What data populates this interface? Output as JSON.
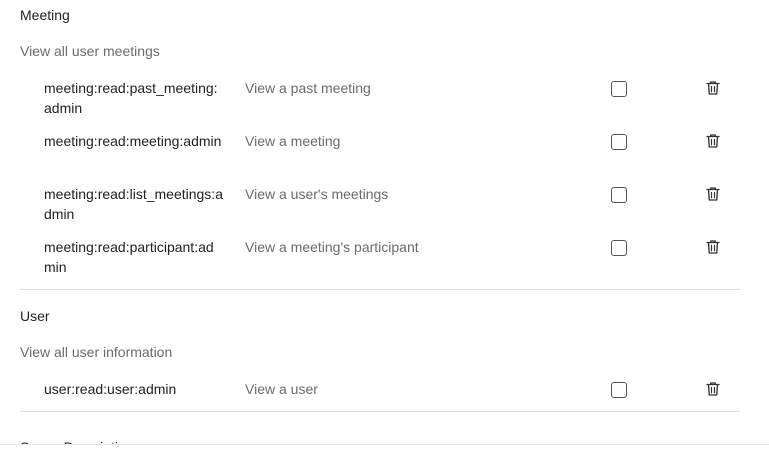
{
  "meeting": {
    "title": "Meeting",
    "subtitle": "View all user meetings",
    "rows": [
      {
        "scope": "meeting:read:past_meeting:admin",
        "description": "View a past meeting",
        "checked": false
      },
      {
        "scope": "meeting:read:meeting:admin",
        "description": "View a meeting",
        "checked": false
      },
      {
        "scope": "meeting:read:list_meetings:admin",
        "description": "View a user's meetings",
        "checked": false
      },
      {
        "scope": "meeting:read:participant:admin",
        "description": "View a meeting's participant",
        "checked": false
      }
    ]
  },
  "user": {
    "title": "User",
    "subtitle": "View all user information",
    "rows": [
      {
        "scope": "user:read:user:admin",
        "description": "View a user",
        "checked": false
      }
    ]
  },
  "next_section": {
    "title": "Scope Description"
  },
  "icons": {
    "row_action": "trash-icon"
  },
  "colors": {
    "text_primary": "#222222",
    "text_secondary": "#6b6b6b",
    "divider": "#dcdcdc"
  }
}
